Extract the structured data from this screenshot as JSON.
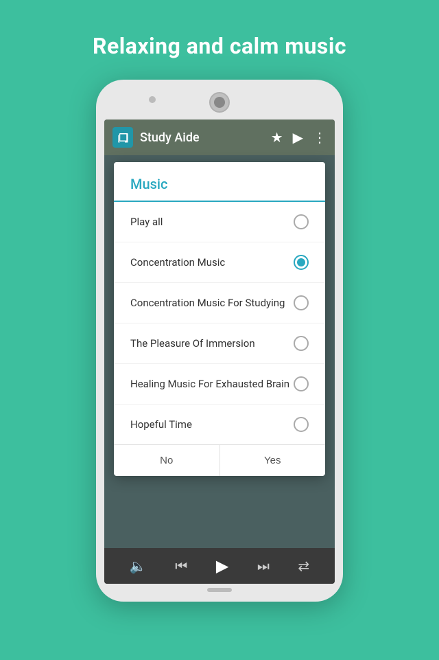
{
  "page": {
    "headline": "Relaxing and calm music",
    "background_color": "#3dbf9e"
  },
  "app_bar": {
    "title": "Study Aide",
    "logo_alt": "book-icon"
  },
  "dialog": {
    "title": "Music",
    "items": [
      {
        "id": "play-all",
        "label": "Play all",
        "selected": false
      },
      {
        "id": "concentration-music",
        "label": "Concentration Music",
        "selected": true
      },
      {
        "id": "concentration-music-studying",
        "label": "Concentration Music For Studying",
        "selected": false
      },
      {
        "id": "pleasure-immersion",
        "label": "The Pleasure Of Immersion",
        "selected": false
      },
      {
        "id": "healing-music",
        "label": "Healing Music For Exhausted Brain",
        "selected": false
      },
      {
        "id": "hopeful-time",
        "label": "Hopeful Time",
        "selected": false
      }
    ],
    "buttons": {
      "cancel_label": "No",
      "confirm_label": "Yes"
    }
  },
  "player": {
    "icons": [
      "volume",
      "skip-back",
      "play",
      "skip-forward",
      "shuffle"
    ]
  }
}
